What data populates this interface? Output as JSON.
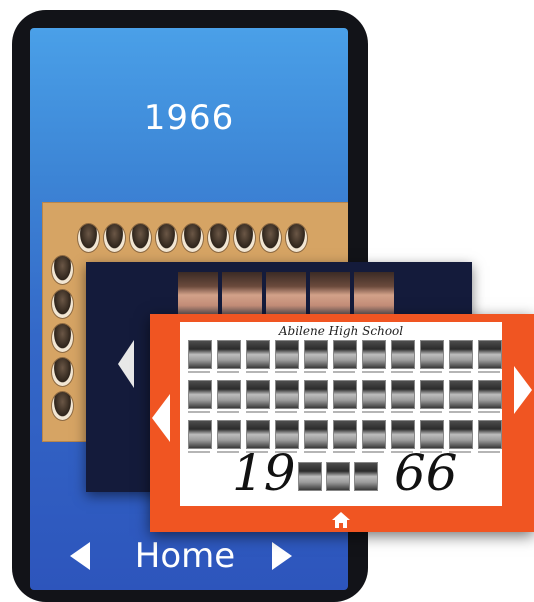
{
  "phone": {
    "year_title": "1966",
    "home_label": "Home"
  },
  "yearbook": {
    "school_title": "Abilene High School",
    "year_left": "19",
    "year_right": "66"
  },
  "colors": {
    "phone_gradient_top": "#4aa0e8",
    "phone_gradient_bottom": "#2d55bc",
    "navy_panel": "#141b3b",
    "orange_panel": "#f05522",
    "sepia_composite": "#d6a464"
  },
  "icons": [
    "arrow-left-icon",
    "arrow-right-icon",
    "home-icon"
  ]
}
